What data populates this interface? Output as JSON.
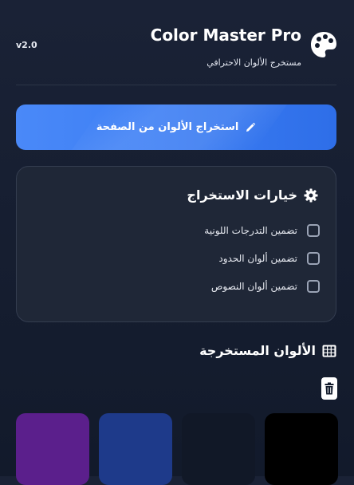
{
  "header": {
    "version": "v2.0",
    "title": "Color Master Pro",
    "subtitle": "مستخرج الألوان الاحترافي",
    "icon": "palette-icon"
  },
  "extract_button": {
    "label": "استخراج الألوان من الصفحة",
    "icon": "pencil-icon",
    "color": "#3c7ef4"
  },
  "options": {
    "title": "خيارات الاستخراج",
    "icon": "gear-icon",
    "items": [
      {
        "label": "تضمين التدرجات اللونية",
        "checked": false
      },
      {
        "label": "تضمين ألوان الحدود",
        "checked": false
      },
      {
        "label": "تضمين ألوان النصوص",
        "checked": false
      }
    ]
  },
  "extracted_colors": {
    "title": "الألوان المستخرجة",
    "icon": "grid-icon",
    "clear_icon": "trash-icon",
    "swatches": [
      "#5b1f8c",
      "#1e3a8a",
      "#111827",
      "#000000"
    ]
  }
}
